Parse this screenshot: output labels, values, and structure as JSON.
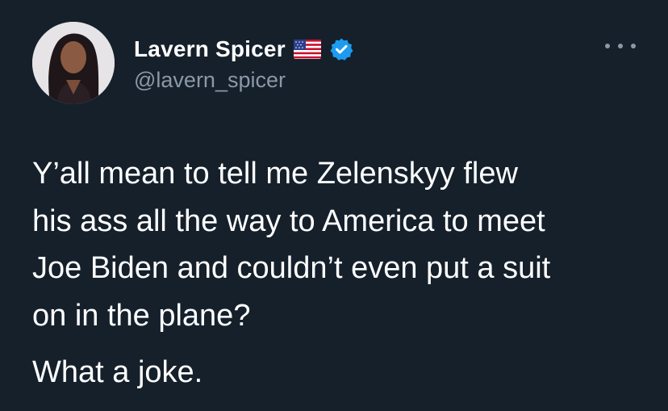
{
  "author": {
    "display_name": "Lavern Spicer",
    "handle": "@lavern_spicer"
  },
  "icons": {
    "flag": "us-flag-emoji",
    "verified": "verified-badge-icon",
    "more": "more-options-icon"
  },
  "tweet": {
    "text": "Y’all mean to tell me Zelenskyy flew\nhis ass all the way to America to meet\nJoe Biden and couldn’t even put a suit\non in the plane?",
    "text_2": "What a joke."
  },
  "colors": {
    "background": "#15202b",
    "text": "#ffffff",
    "secondary": "#8b98a5",
    "verified": "#1d9bf0"
  }
}
